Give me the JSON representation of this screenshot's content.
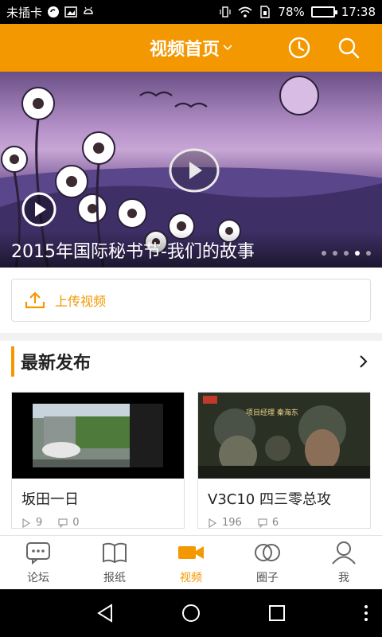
{
  "status_bar": {
    "carrier": "未插卡",
    "battery_percent": "78%",
    "battery_level": 0.78,
    "time": "17:38",
    "icons": [
      "sync-icon",
      "image-icon",
      "android-icon",
      "vibrate-icon",
      "wifi-icon",
      "sim-icon",
      "battery-icon"
    ]
  },
  "header": {
    "title": "视频首页",
    "title_dropdown_icon": "chevron-down-icon",
    "icons": [
      "history-clock-icon",
      "search-icon"
    ],
    "colors": {
      "accent": "#f39800"
    }
  },
  "banner": {
    "title": "2015年国际秘书节-我们的故事",
    "slide_count": 5,
    "active_slide": 4
  },
  "upload": {
    "label": "上传视频",
    "icon": "upload-icon"
  },
  "section": {
    "title": "最新发布",
    "more_icon": "chevron-right-icon"
  },
  "videos": [
    {
      "title": "坂田一日",
      "plays": "9",
      "comments": "0"
    },
    {
      "title": "V3C10 四三零总攻",
      "plays": "196",
      "comments": "6"
    }
  ],
  "tabs": [
    {
      "label": "论坛",
      "icon": "chat-bubble-icon",
      "active": false
    },
    {
      "label": "报纸",
      "icon": "book-icon",
      "active": false
    },
    {
      "label": "视频",
      "icon": "video-camera-icon",
      "active": true
    },
    {
      "label": "圈子",
      "icon": "circles-icon",
      "active": false
    },
    {
      "label": "我",
      "icon": "person-icon",
      "active": false
    }
  ],
  "system_nav": {
    "icons": [
      "back-triangle-icon",
      "home-circle-icon",
      "recents-square-icon",
      "menu-dots-icon"
    ]
  }
}
